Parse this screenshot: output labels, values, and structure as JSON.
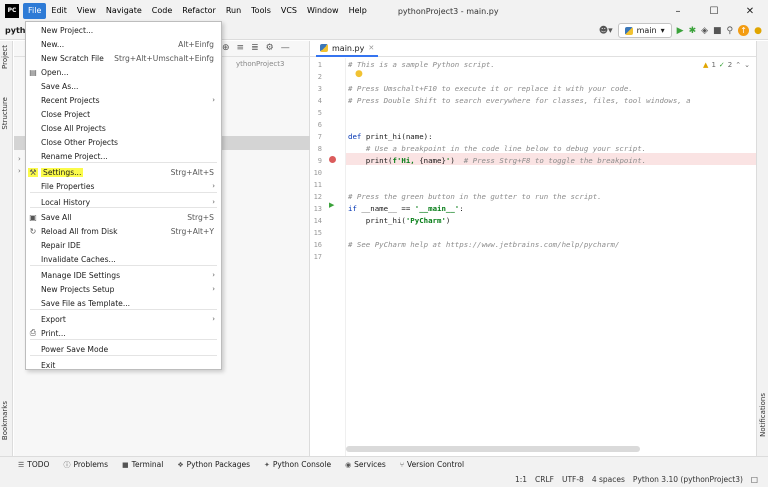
{
  "window": {
    "app_icon": "PC",
    "title": "pythonProject3 - main.py",
    "controls": [
      "–",
      "☐",
      "✕"
    ]
  },
  "menubar": [
    "File",
    "Edit",
    "View",
    "Navigate",
    "Code",
    "Refactor",
    "Run",
    "Tools",
    "VCS",
    "Window",
    "Help"
  ],
  "toolbar": {
    "project_crumb": "pyth",
    "branch": "main",
    "icons": [
      "user-icon",
      "run-icon",
      "debug-icon",
      "coverage-icon",
      "stop-icon",
      "search-icon",
      "update-icon",
      "ide-logo-icon"
    ]
  },
  "left_strip": {
    "project_tab": "Project",
    "structure_tab": "Structure",
    "bookmarks_tab": "Bookmarks"
  },
  "right_strip": {
    "notifications_tab": "Notifications"
  },
  "project_pane": {
    "path_fragment": "ythonProject3"
  },
  "editor": {
    "tab_name": "main.py",
    "inspection": {
      "warnings": "1",
      "weak_warnings": "2"
    },
    "line_numbers": [
      "1",
      "2",
      "3",
      "4",
      "5",
      "6",
      "7",
      "8",
      "9",
      "10",
      "11",
      "12",
      "13",
      "14",
      "15",
      "16",
      "17"
    ],
    "lines": [
      {
        "n": 1,
        "parts": [
          {
            "c": "cm",
            "t": "# This is a sample Python script."
          }
        ]
      },
      {
        "n": 3,
        "parts": [
          {
            "c": "cm",
            "t": "# Press Umschalt+F10 to execute it or replace it with your code."
          }
        ]
      },
      {
        "n": 4,
        "parts": [
          {
            "c": "cm",
            "t": "# Press Double Shift to search everywhere for classes, files, tool windows, a"
          }
        ]
      },
      {
        "n": 7,
        "parts": [
          {
            "c": "kw",
            "t": "def "
          },
          {
            "c": "",
            "t": "print_hi(name):"
          }
        ]
      },
      {
        "n": 8,
        "parts": [
          {
            "c": "",
            "t": "    "
          },
          {
            "c": "cm",
            "t": "# Use a breakpoint in the code line below to debug your script."
          }
        ]
      },
      {
        "n": 9,
        "parts": [
          {
            "c": "",
            "t": "    print("
          },
          {
            "c": "str",
            "t": "f'Hi, "
          },
          {
            "c": "",
            "t": "{name}"
          },
          {
            "c": "str",
            "t": "'"
          },
          {
            "c": "",
            "t": ")  "
          },
          {
            "c": "cm",
            "t": "# Press Strg+F8 to toggle the breakpoint."
          }
        ]
      },
      {
        "n": 12,
        "parts": [
          {
            "c": "cm",
            "t": "# Press the green button in the gutter to run the script."
          }
        ]
      },
      {
        "n": 13,
        "parts": [
          {
            "c": "kw",
            "t": "if "
          },
          {
            "c": "",
            "t": "__name__ == "
          },
          {
            "c": "str",
            "t": "'__main__'"
          },
          {
            "c": "",
            "t": ":"
          }
        ]
      },
      {
        "n": 14,
        "parts": [
          {
            "c": "",
            "t": "    print_hi("
          },
          {
            "c": "str",
            "t": "'PyCharm'"
          },
          {
            "c": "",
            "t": ")"
          }
        ]
      },
      {
        "n": 16,
        "parts": [
          {
            "c": "cm",
            "t": "# See PyCharm help at https://www.jetbrains.com/help/pycharm/"
          }
        ]
      }
    ]
  },
  "file_menu": {
    "items": [
      {
        "label": "New Project...",
        "shortcut": "",
        "icon": "",
        "submenu": false
      },
      {
        "label": "New...",
        "shortcut": "Alt+Einfg",
        "icon": "",
        "submenu": false
      },
      {
        "label": "New Scratch File",
        "shortcut": "Strg+Alt+Umschalt+Einfg",
        "icon": "",
        "submenu": false
      },
      {
        "label": "Open...",
        "shortcut": "",
        "icon": "folder-icon",
        "submenu": false
      },
      {
        "label": "Save As...",
        "shortcut": "",
        "icon": "",
        "submenu": false
      },
      {
        "label": "Recent Projects",
        "shortcut": "",
        "icon": "",
        "submenu": true
      },
      {
        "label": "Close Project",
        "shortcut": "",
        "icon": "",
        "submenu": false
      },
      {
        "label": "Close All Projects",
        "shortcut": "",
        "icon": "",
        "submenu": false
      },
      {
        "label": "Close Other Projects",
        "shortcut": "",
        "icon": "",
        "submenu": false
      },
      {
        "label": "Rename Project...",
        "shortcut": "",
        "icon": "",
        "submenu": false
      },
      {
        "label": "Settings...",
        "shortcut": "Strg+Alt+S",
        "icon": "wrench-icon",
        "submenu": false,
        "highlighted": true
      },
      {
        "label": "File Properties",
        "shortcut": "",
        "icon": "",
        "submenu": true
      },
      {
        "label": "Local History",
        "shortcut": "",
        "icon": "",
        "submenu": true
      },
      {
        "label": "Save All",
        "shortcut": "Strg+S",
        "icon": "save-icon",
        "submenu": false
      },
      {
        "label": "Reload All from Disk",
        "shortcut": "Strg+Alt+Y",
        "icon": "reload-icon",
        "submenu": false
      },
      {
        "label": "Repair IDE",
        "shortcut": "",
        "icon": "",
        "submenu": false
      },
      {
        "label": "Invalidate Caches...",
        "shortcut": "",
        "icon": "",
        "submenu": false
      },
      {
        "label": "Manage IDE Settings",
        "shortcut": "",
        "icon": "",
        "submenu": true
      },
      {
        "label": "New Projects Setup",
        "shortcut": "",
        "icon": "",
        "submenu": true
      },
      {
        "label": "Save File as Template...",
        "shortcut": "",
        "icon": "",
        "submenu": false
      },
      {
        "label": "Export",
        "shortcut": "",
        "icon": "",
        "submenu": true
      },
      {
        "label": "Print...",
        "shortcut": "",
        "icon": "print-icon",
        "submenu": false
      },
      {
        "label": "Power Save Mode",
        "shortcut": "",
        "icon": "",
        "submenu": false
      },
      {
        "label": "Exit",
        "shortcut": "",
        "icon": "",
        "submenu": false
      }
    ]
  },
  "bottom_tools": [
    {
      "label": "TODO",
      "icon": "list-icon"
    },
    {
      "label": "Problems",
      "icon": "problems-icon"
    },
    {
      "label": "Terminal",
      "icon": "terminal-icon"
    },
    {
      "label": "Python Packages",
      "icon": "packages-icon"
    },
    {
      "label": "Python Console",
      "icon": "console-icon"
    },
    {
      "label": "Services",
      "icon": "services-icon"
    },
    {
      "label": "Version Control",
      "icon": "vcs-icon"
    }
  ],
  "statusbar": {
    "position": "1:1",
    "line_sep": "CRLF",
    "encoding": "UTF-8",
    "indent": "4 spaces",
    "interpreter": "Python 3.10 (pythonProject3)"
  },
  "colors": {
    "menu_active": "#2e7bd6",
    "highlight": "#fbfb4a",
    "breakpoint": "#db5c5c",
    "run_green": "#3aa23a"
  }
}
